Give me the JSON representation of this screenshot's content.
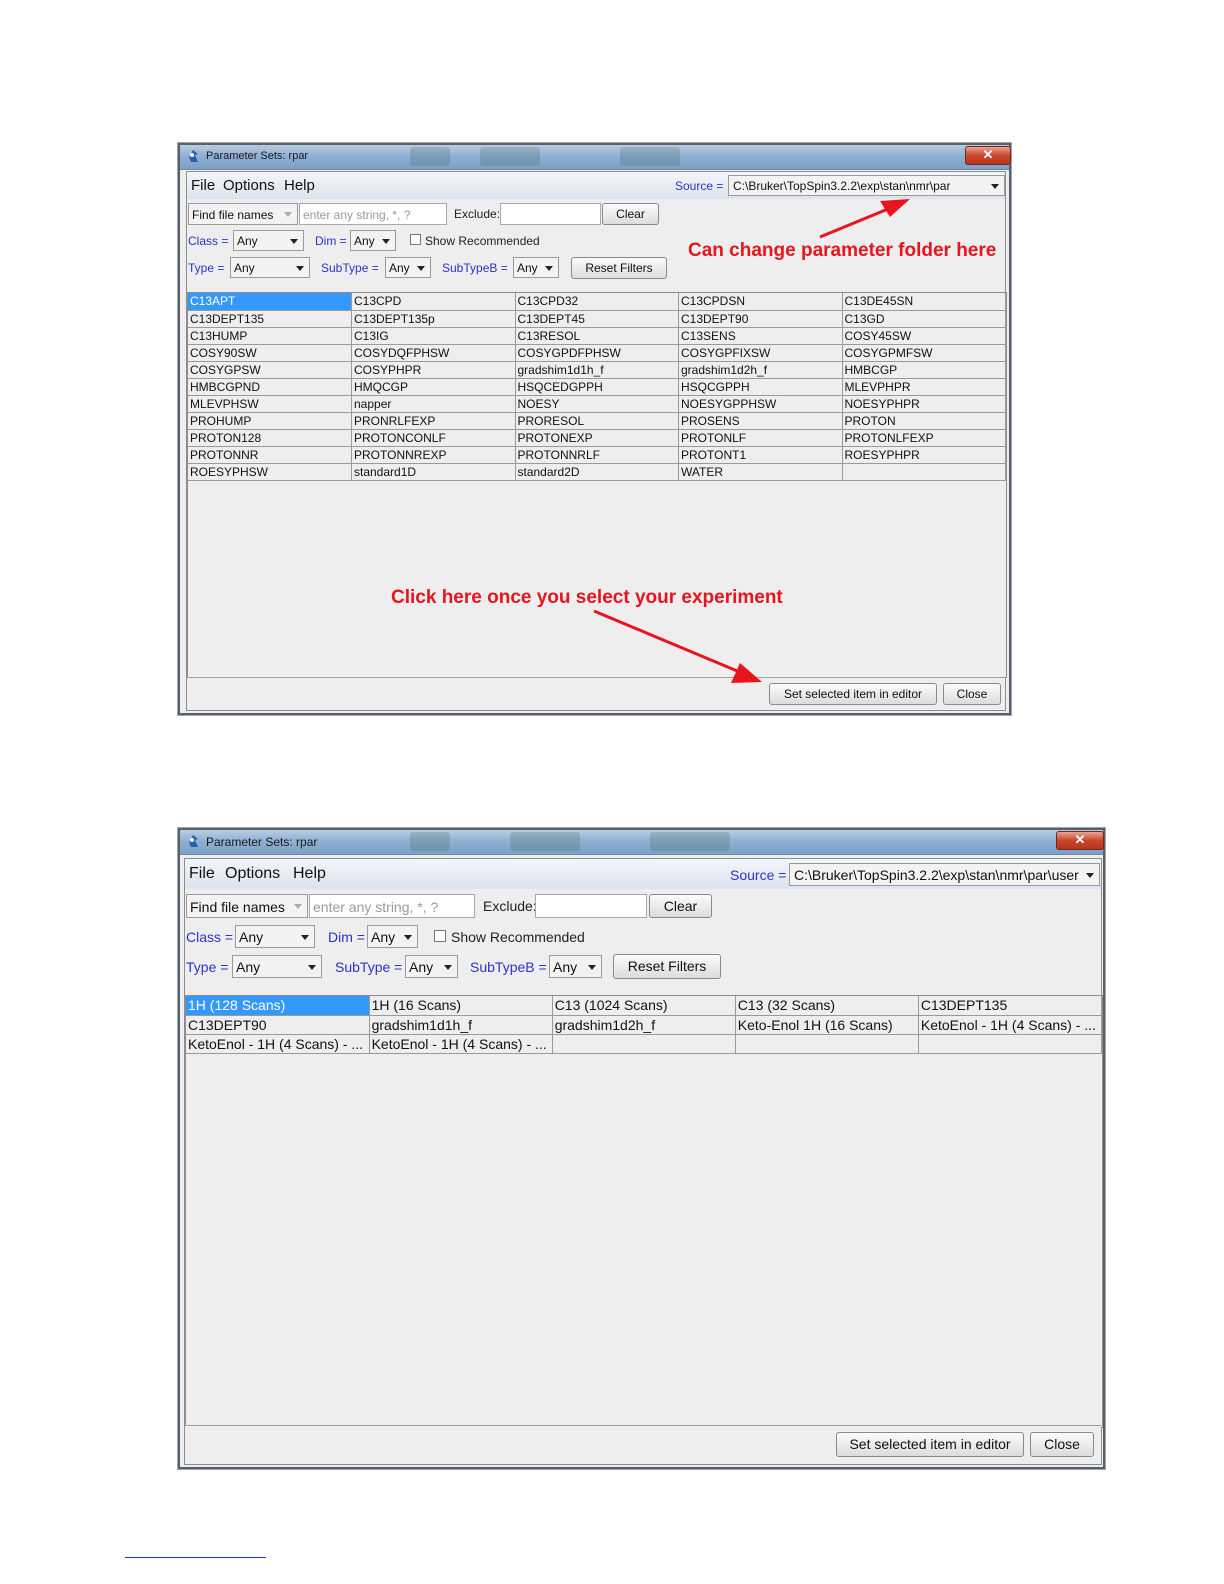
{
  "window1": {
    "title": "Parameter Sets: rpar",
    "close_glyph": "✕",
    "menu": [
      "File",
      "Options",
      "Help"
    ],
    "source_label": "Source =",
    "source_value": "C:\\Bruker\\TopSpin3.2.2\\exp\\stan\\nmr\\par",
    "find_mode": "Find file names",
    "search_placeholder": "enter any string, *, ?",
    "exclude_label": "Exclude:",
    "exclude_value": "",
    "clear_label": "Clear",
    "class_label": "Class =",
    "class_value": "Any",
    "dim_label": "Dim =",
    "dim_value": "Any",
    "show_recommended_label": "Show Recommended",
    "type_label": "Type =",
    "type_value": "Any",
    "subtype_label": "SubType =",
    "subtype_value": "Any",
    "subtypeb_label": "SubTypeB =",
    "subtypeb_value": "Any",
    "reset_label": "Reset Filters",
    "rows": [
      [
        "C13APT",
        "C13CPD",
        "C13CPD32",
        "C13CPDSN",
        "C13DE45SN"
      ],
      [
        "C13DEPT135",
        "C13DEPT135p",
        "C13DEPT45",
        "C13DEPT90",
        "C13GD"
      ],
      [
        "C13HUMP",
        "C13IG",
        "C13RESOL",
        "C13SENS",
        "COSY45SW"
      ],
      [
        "COSY90SW",
        "COSYDQFPHSW",
        "COSYGPDFPHSW",
        "COSYGPFIXSW",
        "COSYGPMFSW"
      ],
      [
        "COSYGPSW",
        "COSYPHPR",
        "gradshim1d1h_f",
        "gradshim1d2h_f",
        "HMBCGP"
      ],
      [
        "HMBCGPND",
        "HMQCGP",
        "HSQCEDGPPH",
        "HSQCGPPH",
        "MLEVPHPR"
      ],
      [
        "MLEVPHSW",
        "napper",
        "NOESY",
        "NOESYGPPHSW",
        "NOESYPHPR"
      ],
      [
        "PROHUMP",
        "PRONRLFEXP",
        "PRORESOL",
        "PROSENS",
        "PROTON"
      ],
      [
        "PROTON128",
        "PROTONCONLF",
        "PROTONEXP",
        "PROTONLF",
        "PROTONLFEXP"
      ],
      [
        "PROTONNR",
        "PROTONNREXP",
        "PROTONNRLF",
        "PROTONT1",
        "ROESYPHPR"
      ],
      [
        "ROESYPHSW",
        "standard1D",
        "standard2D",
        "WATER",
        ""
      ]
    ],
    "set_label": "Set selected item in editor",
    "close_label": "Close",
    "annotation_source": "Can change parameter folder here",
    "annotation_click": "Click here once you select your experiment"
  },
  "window2": {
    "title": "Parameter Sets: rpar",
    "close_glyph": "✕",
    "menu": [
      "File",
      "Options",
      "Help"
    ],
    "source_label": "Source =",
    "source_value": "C:\\Bruker\\TopSpin3.2.2\\exp\\stan\\nmr\\par\\user",
    "find_mode": "Find file names",
    "search_placeholder": "enter any string, *, ?",
    "exclude_label": "Exclude:",
    "exclude_value": "",
    "clear_label": "Clear",
    "class_label": "Class =",
    "class_value": "Any",
    "dim_label": "Dim =",
    "dim_value": "Any",
    "show_recommended_label": "Show Recommended",
    "type_label": "Type =",
    "type_value": "Any",
    "subtype_label": "SubType =",
    "subtype_value": "Any",
    "subtypeb_label": "SubTypeB =",
    "subtypeb_value": "Any",
    "reset_label": "Reset Filters",
    "rows": [
      [
        "1H (128 Scans)",
        "1H (16 Scans)",
        "C13 (1024 Scans)",
        "C13 (32 Scans)",
        "C13DEPT135"
      ],
      [
        "C13DEPT90",
        "gradshim1d1h_f",
        "gradshim1d2h_f",
        "Keto-Enol 1H (16 Scans)",
        "KetoEnol - 1H (4 Scans) - ..."
      ],
      [
        "KetoEnol - 1H (4 Scans) - ...",
        "KetoEnol - 1H (4 Scans) - ...",
        "",
        "",
        ""
      ]
    ],
    "set_label": "Set selected item in editor",
    "close_label": "Close"
  }
}
